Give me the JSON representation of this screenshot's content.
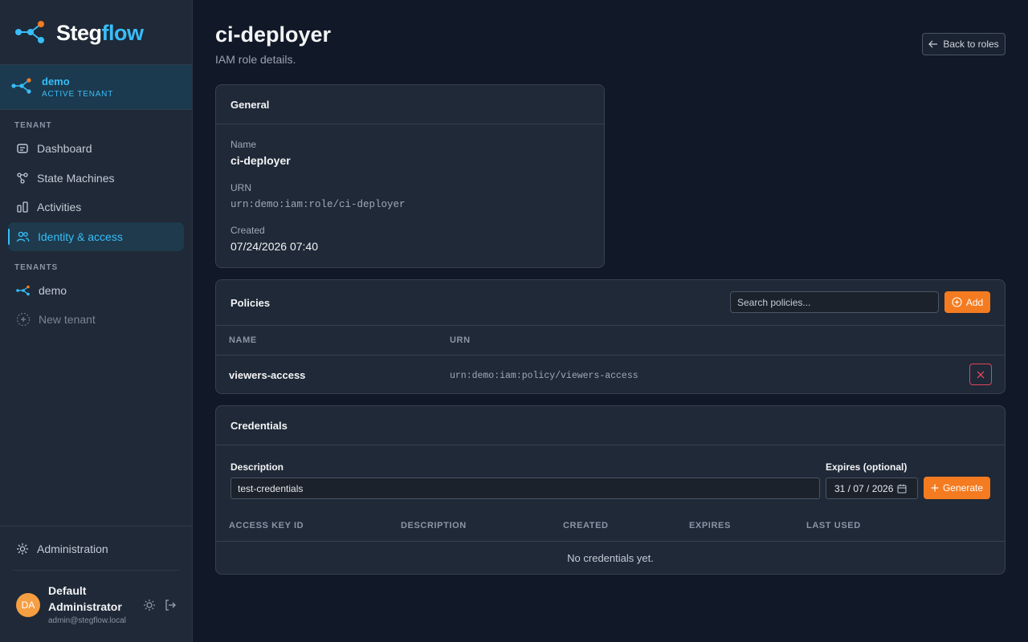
{
  "brand": {
    "name_part1": "Steg",
    "name_part2": "flow",
    "accent": "#38bdf8"
  },
  "active_tenant": {
    "name": "demo",
    "label": "ACTIVE TENANT"
  },
  "sidebar": {
    "tenant_section": "TENANT",
    "items": [
      {
        "label": "Dashboard",
        "icon": "dashboard-icon"
      },
      {
        "label": "State Machines",
        "icon": "state-machine-icon"
      },
      {
        "label": "Activities",
        "icon": "activities-icon"
      },
      {
        "label": "Identity & access",
        "icon": "users-icon"
      }
    ],
    "tenants_section": "TENANTS",
    "tenants": [
      {
        "label": "demo"
      }
    ],
    "new_tenant": "New tenant",
    "administration": "Administration"
  },
  "user": {
    "initials": "DA",
    "name": "Default Administrator",
    "email": "admin@stegflow.local"
  },
  "page": {
    "title": "ci-deployer",
    "subtitle": "IAM role details.",
    "back_label": "Back to roles"
  },
  "general": {
    "title": "General",
    "name_label": "Name",
    "name_value": "ci-deployer",
    "urn_label": "URN",
    "urn_value": "urn:demo:iam:role/ci-deployer",
    "created_label": "Created",
    "created_value": "07/24/2026 07:40"
  },
  "policies": {
    "title": "Policies",
    "search_placeholder": "Search policies...",
    "add_label": "Add",
    "columns": [
      "NAME",
      "URN"
    ],
    "rows": [
      {
        "name": "viewers-access",
        "urn": "urn:demo:iam:policy/viewers-access"
      }
    ]
  },
  "credentials": {
    "title": "Credentials",
    "description_label": "Description",
    "description_value": "test-credentials",
    "expires_label": "Expires (optional)",
    "expires_value": "31 / 07 / 2026",
    "generate_label": "Generate",
    "columns": [
      "ACCESS KEY ID",
      "DESCRIPTION",
      "CREATED",
      "EXPIRES",
      "LAST USED"
    ],
    "empty_text": "No credentials yet."
  },
  "colors": {
    "orange": "#f47b20",
    "danger": "#e0435c",
    "background": "#111827"
  }
}
